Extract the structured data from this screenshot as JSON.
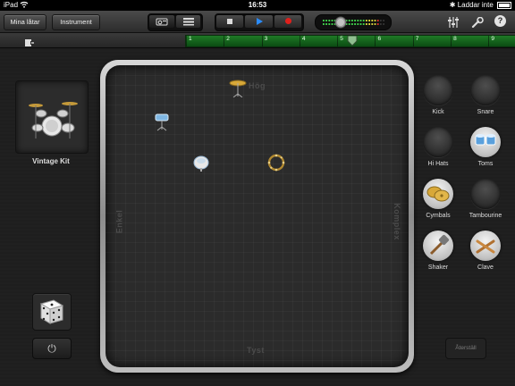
{
  "status": {
    "device": "iPad",
    "time": "16:53",
    "battery_text": "Laddar inte"
  },
  "toolbar": {
    "my_songs": "Mina låtar",
    "instrument": "Instrument",
    "view_icons": [
      "drum-view-icon",
      "tracks-view-icon"
    ],
    "transport_icons": [
      "stop-icon",
      "play-icon",
      "record-icon"
    ],
    "right_icons": [
      "mixer-icon",
      "wrench-icon",
      "help-icon"
    ],
    "help_glyph": "?"
  },
  "ruler": {
    "markers": [
      "1",
      "2",
      "3",
      "4",
      "5",
      "6",
      "7",
      "8",
      "9"
    ],
    "playhead_bar": 5.4
  },
  "kit": {
    "name": "Vintage Kit"
  },
  "pad": {
    "top": "Hög",
    "bottom": "Tyst",
    "left": "Enkel",
    "right": "Komplex"
  },
  "drums": [
    {
      "label": "Kick",
      "active": false
    },
    {
      "label": "Snare",
      "active": false
    },
    {
      "label": "Hi Hats",
      "active": false
    },
    {
      "label": "Toms",
      "active": true
    },
    {
      "label": "Cymbals",
      "active": true
    },
    {
      "label": "Tambourine",
      "active": false
    },
    {
      "label": "Shaker",
      "active": true
    },
    {
      "label": "Clave",
      "active": true
    }
  ],
  "reset_label": "Återställ",
  "colors": {
    "ruler_green": "#1f7a26",
    "play_blue": "#2a8cff",
    "record_red": "#e0201c",
    "cymbal_gold": "#d8a838"
  }
}
